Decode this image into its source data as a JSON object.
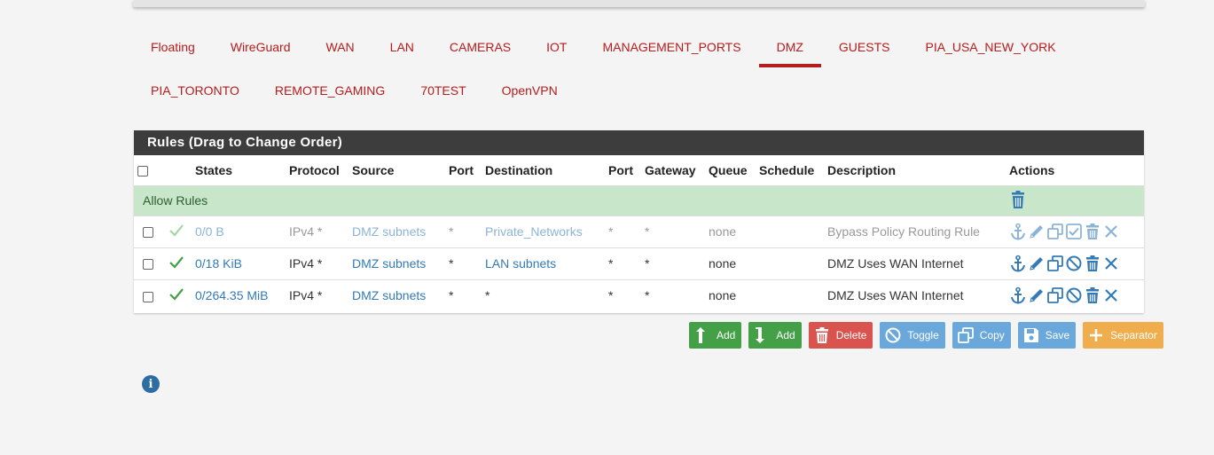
{
  "tabs_row1": [
    "Floating",
    "WireGuard",
    "WAN",
    "LAN",
    "CAMERAS",
    "IOT",
    "MANAGEMENT_PORTS",
    "DMZ",
    "GUESTS",
    "PIA_USA_NEW_YORK"
  ],
  "tabs_row2": [
    "PIA_TORONTO",
    "REMOTE_GAMING",
    "70TEST",
    "OpenVPN"
  ],
  "active_tab": "DMZ",
  "panel": {
    "title": "Rules (Drag to Change Order)"
  },
  "columns": {
    "states": "States",
    "protocol": "Protocol",
    "source": "Source",
    "port": "Port",
    "destination": "Destination",
    "port2": "Port",
    "gateway": "Gateway",
    "queue": "Queue",
    "schedule": "Schedule",
    "description": "Description",
    "actions": "Actions"
  },
  "separator": {
    "label": "Allow Rules"
  },
  "rules": [
    {
      "states": "0/0 B",
      "protocol": "IPv4 *",
      "source": "DMZ subnets",
      "port": "*",
      "destination": "Private_Networks",
      "dport": "*",
      "gateway": "*",
      "queue": "none",
      "schedule": "",
      "description": "Bypass Policy Routing Rule"
    },
    {
      "states": "0/18 KiB",
      "protocol": "IPv4 *",
      "source": "DMZ subnets",
      "port": "*",
      "destination": "LAN subnets",
      "dport": "*",
      "gateway": "*",
      "queue": "none",
      "schedule": "",
      "description": "DMZ Uses WAN Internet"
    },
    {
      "states": "0/264.35 MiB",
      "protocol": "IPv4 *",
      "source": "DMZ subnets",
      "port": "*",
      "destination": "*",
      "dport": "*",
      "gateway": "*",
      "queue": "none",
      "schedule": "",
      "description": "DMZ Uses WAN Internet"
    }
  ],
  "buttons": {
    "add_top": "Add",
    "add_bottom": "Add",
    "delete": "Delete",
    "toggle": "Toggle",
    "copy": "Copy",
    "save": "Save",
    "separator": "Separator"
  },
  "colors": {
    "accent": "#b71c1c",
    "link": "#337ab7",
    "separator_bg": "#c8e6c9"
  }
}
